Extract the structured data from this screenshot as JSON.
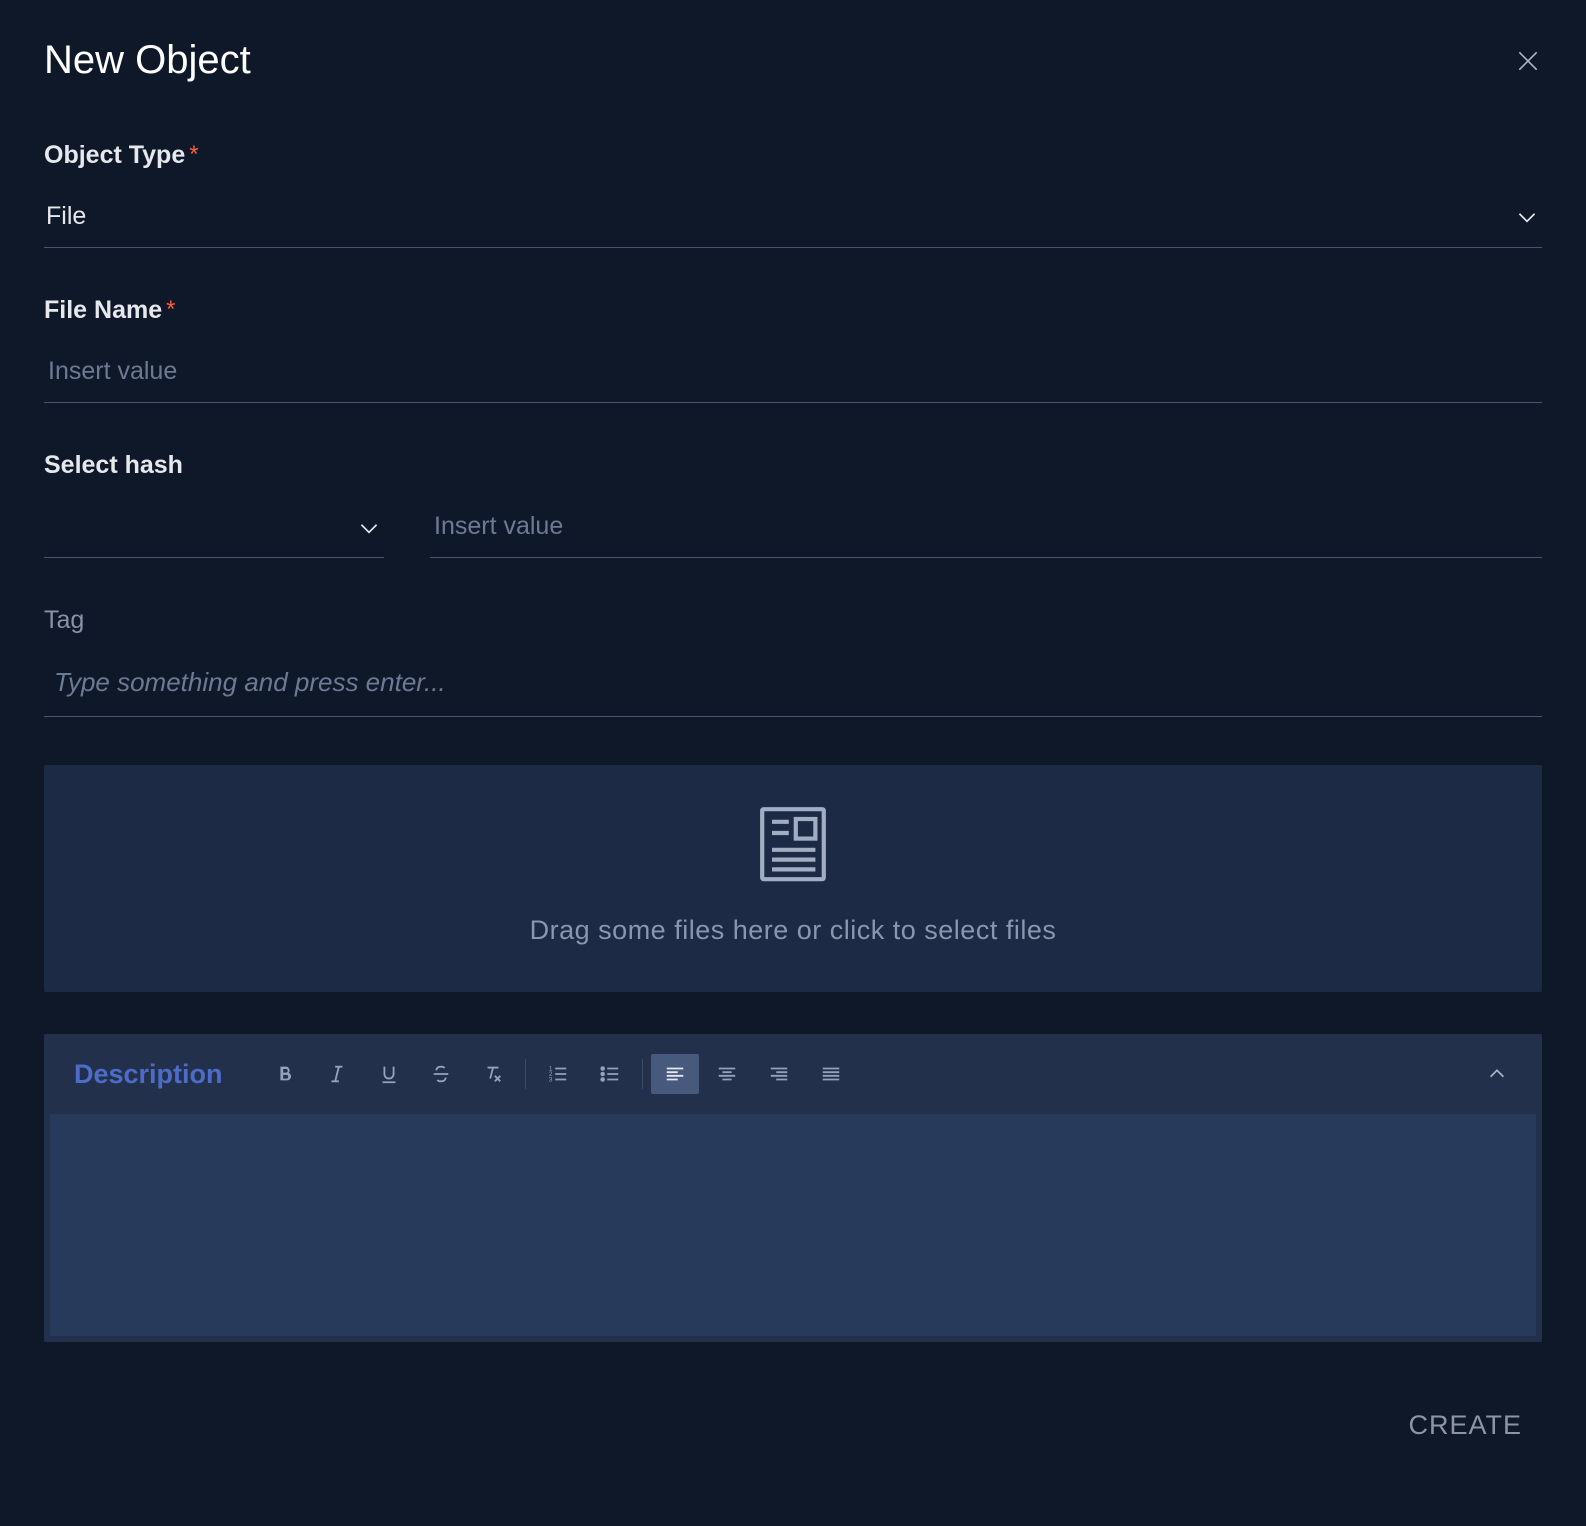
{
  "dialog": {
    "title": "New Object"
  },
  "fields": {
    "object_type": {
      "label": "Object Type",
      "value": "File",
      "required": true
    },
    "file_name": {
      "label": "File Name",
      "placeholder": "Insert value",
      "required": true
    },
    "select_hash": {
      "label": "Select hash",
      "value_placeholder": "Insert value"
    },
    "tag": {
      "label": "Tag",
      "placeholder": "Type something and press enter..."
    },
    "dropzone": {
      "text": "Drag some files here or click to select files"
    },
    "description": {
      "label": "Description"
    }
  },
  "actions": {
    "create": "CREATE"
  },
  "icons": {
    "close": "close-icon",
    "chevron_down": "chevron-down-icon",
    "document": "document-icon",
    "chevron_up": "chevron-up-icon"
  },
  "editor_toolbar": {
    "bold": "bold-icon",
    "italic": "italic-icon",
    "underline": "underline-icon",
    "strikethrough": "strikethrough-icon",
    "clear_format": "clear-format-icon",
    "ordered_list": "ordered-list-icon",
    "unordered_list": "unordered-list-icon",
    "align_left": "align-left-icon",
    "align_center": "align-center-icon",
    "align_right": "align-right-icon",
    "align_justify": "align-justify-icon"
  },
  "colors": {
    "background": "#0f1829",
    "panel": "#1c2a45",
    "editor_bar": "#22304c",
    "editor_body": "#283a5c",
    "accent": "#4d6cc7",
    "required": "#ff5a3c"
  }
}
